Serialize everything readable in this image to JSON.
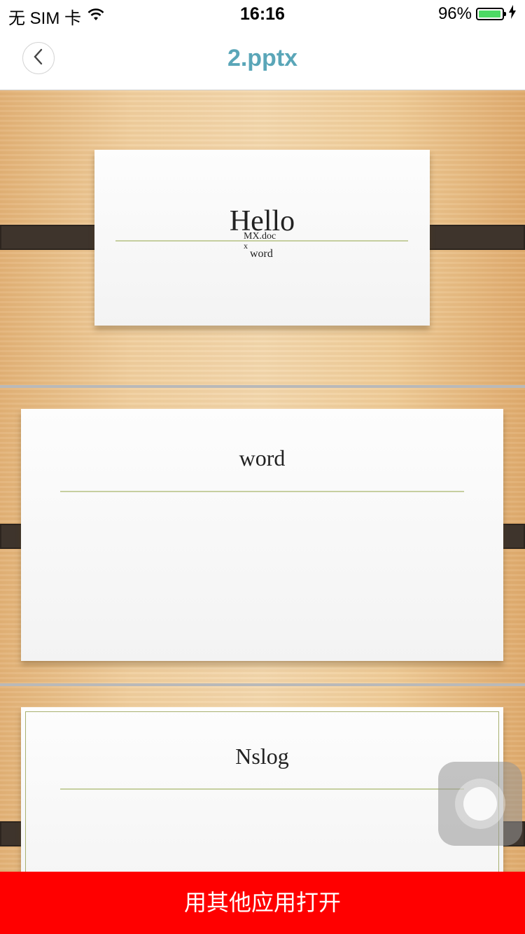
{
  "status_bar": {
    "carrier": "无 SIM 卡",
    "time": "16:16",
    "battery_percent": "96%",
    "battery_level": 0.96,
    "icons": [
      "wifi-icon",
      "battery-icon",
      "charging-bolt-icon"
    ]
  },
  "nav": {
    "title": "2.pptx",
    "back_icon": "chevron-left-icon"
  },
  "slides": [
    {
      "title": "Hello",
      "sub_line1": "MX.doc",
      "sub_line2": "x",
      "sub_line3": "word"
    },
    {
      "title": "word"
    },
    {
      "title": "Nslog"
    }
  ],
  "bottom_button": {
    "label": "用其他应用打开"
  },
  "colors": {
    "title_accent": "#5aa6b8",
    "button_bg": "#ff0000",
    "battery_fill": "#4cd964"
  }
}
